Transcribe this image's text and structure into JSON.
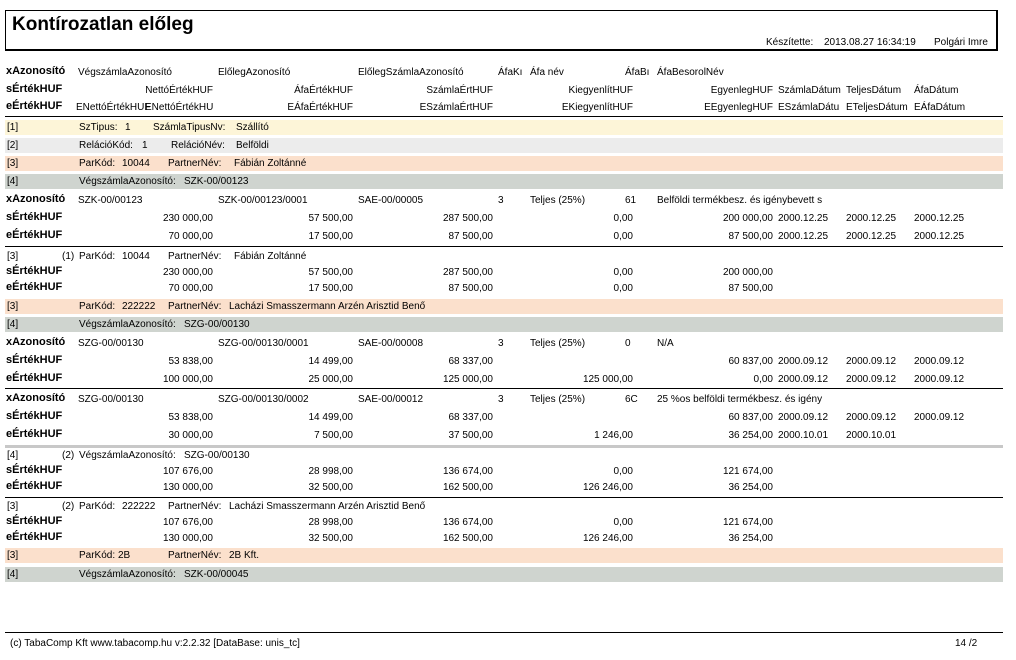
{
  "report": {
    "title": "Kontírozatlan előleg",
    "created_label": "Készítette:",
    "created_at": "2013.08.27 16:34:19",
    "created_by": "Polgári Imre"
  },
  "header": {
    "row1": [
      "xAzonosító",
      "VégszámlaAzonosító",
      "ElőlegAzonosító",
      "ElőlegSzámlaAzonosító",
      "ÁfaKı",
      "Áfa név",
      "ÁfaBı",
      "ÁfaBesorolNév"
    ],
    "row2": [
      "sÉrtékHUF",
      "NettóÉrtékHUF",
      "ÁfaÉrtékHUF",
      "SzámlaÉrtHUF",
      "KiegyenlítHUF",
      "EgyenlegHUF",
      "SzámlaDátum",
      "TeljesDátum",
      "ÁfaDátum"
    ],
    "row3": [
      "eÉrtékHUF",
      "ENettóÉrtékHUF",
      "ENettóÉrtékHU",
      "EÁfaÉrtékHUF",
      "ESzámlaÉrtHUF",
      "EKiegyenlítHUF",
      "EEgyenlegHUF",
      "ESzámlaDátu",
      "ETeljesDátum",
      "EÁfaDátum"
    ]
  },
  "groups": {
    "g1": {
      "idx": "[1]",
      "k1": "SzTipus:",
      "v1": "1",
      "k2": "SzámlaTipusNv:",
      "v2": "Szállító"
    },
    "g2": {
      "idx": "[2]",
      "k1": "RelációKód:",
      "v1": "1",
      "k2": "RelációNév:",
      "v2": "Belföldi"
    },
    "g3a": {
      "idx": "[3]",
      "k1": "ParKód:",
      "v1": "10044",
      "k2": "PartnerNév:",
      "v2": "Fábián Zoltánné"
    },
    "g4a": {
      "idx": "[4]",
      "k1": "VégszámlaAzonosító:",
      "v1": "SZK-00/00123"
    },
    "g3a_sum": {
      "idx": "[3]",
      "cnt": "(1)",
      "k1": "ParKód:",
      "v1": "10044",
      "k2": "PartnerNév:",
      "v2": "Fábián Zoltánné"
    },
    "g3b": {
      "idx": "[3]",
      "k1": "ParKód:",
      "v1": "222222",
      "k2": "PartnerNév:",
      "v2": "Lacházi Smasszermann Arzén Arisztid Benő"
    },
    "g4b": {
      "idx": "[4]",
      "k1": "VégszámlaAzonosító:",
      "v1": "SZG-00/00130"
    },
    "g4b_sum": {
      "idx": "[4]",
      "cnt": "(2)",
      "k1": "VégszámlaAzonosító:",
      "v1": "SZG-00/00130"
    },
    "g3b_sum": {
      "idx": "[3]",
      "cnt": "(2)",
      "k1": "ParKód:",
      "v1": "222222",
      "k2": "PartnerNév:",
      "v2": "Lacházi Smasszermann Arzén Arisztid Benő"
    },
    "g3c": {
      "idx": "[3]",
      "k1": "ParKód:",
      "v1": "2B",
      "k2": "PartnerNév:",
      "v2": "2B Kft."
    },
    "g4c": {
      "idx": "[4]",
      "k1": "VégszámlaAzonosító:",
      "v1": "SZK-00/00045"
    }
  },
  "labels": {
    "x": "xAzonosító",
    "s": "sÉrtékHUF",
    "e": "eÉrtékHUF"
  },
  "records": {
    "r1": {
      "x": [
        "SZK-00/00123",
        "SZK-00/00123/0001",
        "SAE-00/00005",
        "3",
        "Teljes (25%)",
        "61",
        "Belföldi termékbesz. és igénybevett s"
      ],
      "s": [
        "230 000,00",
        "57 500,00",
        "287 500,00",
        "0,00",
        "200 000,00",
        "2000.12.25",
        "2000.12.25",
        "2000.12.25"
      ],
      "e": [
        "70 000,00",
        "17 500,00",
        "87 500,00",
        "0,00",
        "87 500,00",
        "2000.12.25",
        "2000.12.25",
        "2000.12.25"
      ]
    },
    "r1sum": {
      "s": [
        "230 000,00",
        "57 500,00",
        "287 500,00",
        "0,00",
        "200 000,00"
      ],
      "e": [
        "70 000,00",
        "17 500,00",
        "87 500,00",
        "0,00",
        "87 500,00"
      ]
    },
    "r2": {
      "x": [
        "SZG-00/00130",
        "SZG-00/00130/0001",
        "SAE-00/00008",
        "3",
        "Teljes (25%)",
        "0",
        "N/A"
      ],
      "s": [
        "53 838,00",
        "14 499,00",
        "68 337,00",
        "",
        "60 837,00",
        "2000.09.12",
        "2000.09.12",
        "2000.09.12"
      ],
      "e": [
        "100 000,00",
        "25 000,00",
        "125 000,00",
        "125 000,00",
        "0,00",
        "2000.09.12",
        "2000.09.12",
        "2000.09.12"
      ]
    },
    "r3": {
      "x": [
        "SZG-00/00130",
        "SZG-00/00130/0002",
        "SAE-00/00012",
        "3",
        "Teljes (25%)",
        "6C",
        "25 %os belföldi termékbesz. és igény"
      ],
      "s": [
        "53 838,00",
        "14 499,00",
        "68 337,00",
        "",
        "60 837,00",
        "2000.09.12",
        "2000.09.12",
        "2000.09.12"
      ],
      "e": [
        "30 000,00",
        "7 500,00",
        "37 500,00",
        "1 246,00",
        "36 254,00",
        "2000.10.01",
        "2000.10.01",
        ""
      ]
    },
    "r4sum": {
      "s": [
        "107 676,00",
        "28 998,00",
        "136 674,00",
        "0,00",
        "121 674,00"
      ],
      "e": [
        "130 000,00",
        "32 500,00",
        "162 500,00",
        "126 246,00",
        "36 254,00"
      ]
    },
    "r3bsum": {
      "s": [
        "107 676,00",
        "28 998,00",
        "136 674,00",
        "0,00",
        "121 674,00"
      ],
      "e": [
        "130 000,00",
        "32 500,00",
        "162 500,00",
        "126 246,00",
        "36 254,00"
      ]
    }
  },
  "footer": {
    "text": "(c) TabaComp Kft  www.tabacomp.hu  v:2.2.32 [DataBase: unis_tc]",
    "page": "14  /2"
  },
  "colors": {
    "band1": "#fdf5d8",
    "band2": "#ececec",
    "band3": "#fbe0cc",
    "band4": "#cfd4cf"
  }
}
